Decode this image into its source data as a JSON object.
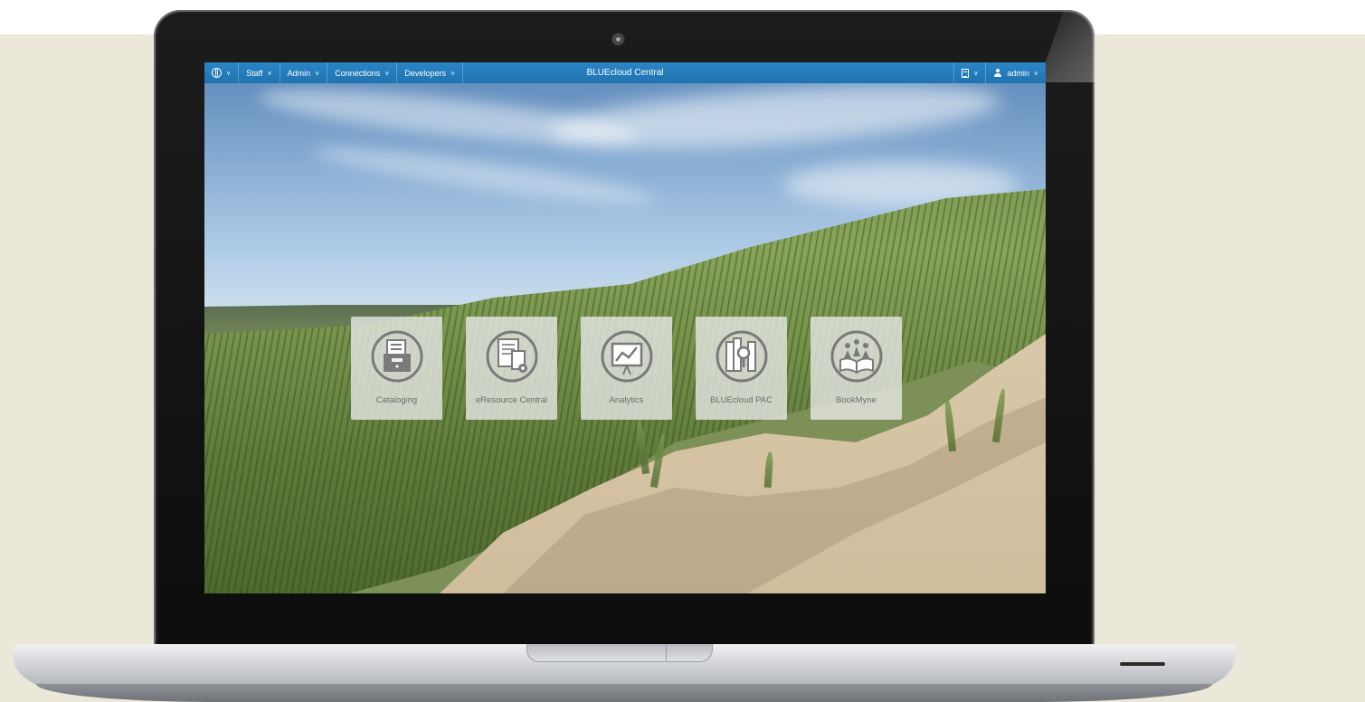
{
  "navbar": {
    "title": "BLUEcloud Central",
    "menus": [
      {
        "label": "Staff"
      },
      {
        "label": "Admin"
      },
      {
        "label": "Connections"
      },
      {
        "label": "Developers"
      }
    ],
    "user_label": "admin",
    "color": "#2a85c5"
  },
  "tiles": [
    {
      "label": "Cataloging",
      "icon": "file-cabinet-icon"
    },
    {
      "label": "eResource Central",
      "icon": "documents-gear-icon"
    },
    {
      "label": "Analytics",
      "icon": "presentation-chart-icon"
    },
    {
      "label": "BLUEcloud PAC",
      "icon": "books-magnifier-icon"
    },
    {
      "label": "BookMyne",
      "icon": "people-book-icon"
    }
  ]
}
